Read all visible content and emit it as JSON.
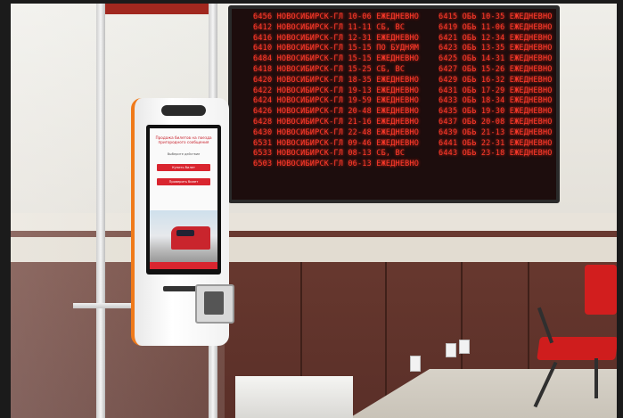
{
  "board": {
    "left_rows": [
      "6456 НОВОСИБИРСК-ГЛ   10-06 ЕЖЕДНЕВНО",
      "6412 НОВОСИБИРСК-ГЛ   11-11 СБ, ВС",
      "6416 НОВОСИБИРСК-ГЛ   12-31 ЕЖЕДНЕВНО",
      "6410 НОВОСИБИРСК-ГЛ   15-15 ПО БУДНЯМ",
      "6484 НОВОСИБИРСК-ГЛ   15-15 ЕЖЕДНЕВНО",
      "6418 НОВОСИБИРСК-ГЛ   15-25 СБ, ВС",
      "6420 НОВОСИБИРСК-ГЛ   18-35 ЕЖЕДНЕВНО",
      "6422 НОВОСИБИРСК-ГЛ   19-13 ЕЖЕДНЕВНО",
      "6424 НОВОСИБИРСК-ГЛ   19-59 ЕЖЕДНЕВНО",
      "6426 НОВОСИБИРСК-ГЛ   20-48 ЕЖЕДНЕВНО",
      "6428 НОВОСИБИРСК-ГЛ   21-16 ЕЖЕДНЕВНО",
      "6430 НОВОСИБИРСК-ГЛ   22-48 ЕЖЕДНЕВНО",
      "6531 НОВОСИБИРСК-ГЛ   09-46 ЕЖЕДНЕВНО",
      "6533 НОВОСИБИРСК-ГЛ   08-13 СБ, ВС",
      "6503 НОВОСИБИРСК-ГЛ   06-13 ЕЖЕДНЕВНО"
    ],
    "right_rows": [
      "6415 ОБЬ  10-35 ЕЖЕДНЕВНО",
      "6419 ОБЬ  11-06 ЕЖЕДНЕВНО",
      "6421 ОБЬ  12-34 ЕЖЕДНЕВНО",
      "6423 ОБЬ  13-35 ЕЖЕДНЕВНО",
      "6425 ОБЬ  14-31 ЕЖЕДНЕВНО",
      "6427 ОБЬ  15-26 ЕЖЕДНЕВНО",
      "6429 ОБЬ  16-32 ЕЖЕДНЕВНО",
      "6431 ОБЬ  17-29 ЕЖЕДНЕВНО",
      "6433 ОБЬ  18-34 ЕЖЕДНЕВНО",
      "6435 ОБЬ  19-30 ЕЖЕДНЕВНО",
      "6437 ОБЬ  20-08 ЕЖЕДНЕВНО",
      "6439 ОБЬ  21-13 ЕЖЕДНЕВНО",
      "6441 ОБЬ  22-31 ЕЖЕДНЕВНО",
      "6443 ОБЬ  23-18 ЕЖЕДНЕВНО"
    ]
  },
  "kiosk": {
    "screen_title": "Продажа билетов на поезда пригородного сообщения",
    "screen_subtitle": "Выберите действие",
    "button_1": "Купить билет",
    "button_2": "Проверить билет"
  },
  "colors": {
    "led": "#ff3b2c",
    "kiosk_accent": "#f07a1a",
    "kiosk_red": "#d9252f",
    "chair": "#d21e1e",
    "wall_panel": "#5a2f28"
  }
}
